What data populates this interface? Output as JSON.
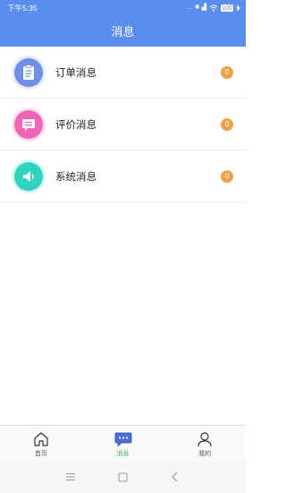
{
  "status_bar": {
    "time": "下午5:35",
    "indicators": "… ✱ ▟",
    "battery": "100"
  },
  "header": {
    "title": "消息"
  },
  "messages": [
    {
      "label": "订单消息",
      "count": "0",
      "icon": "clipboard-icon",
      "color": "#6f8fe6"
    },
    {
      "label": "评价消息",
      "count": "0",
      "icon": "comment-icon",
      "color": "#ef66b7"
    },
    {
      "label": "系统消息",
      "count": "0",
      "icon": "speaker-icon",
      "color": "#2fd3c0"
    }
  ],
  "tabbar": {
    "tabs": [
      {
        "label": "首页",
        "icon": "home-icon",
        "active": false
      },
      {
        "label": "消息",
        "icon": "chat-icon",
        "active": true
      },
      {
        "label": "我的",
        "icon": "person-icon",
        "active": false
      }
    ]
  },
  "colors": {
    "accent": "#5b8def",
    "badge": "#f0a04a",
    "active_tab": "#3aa85a"
  }
}
